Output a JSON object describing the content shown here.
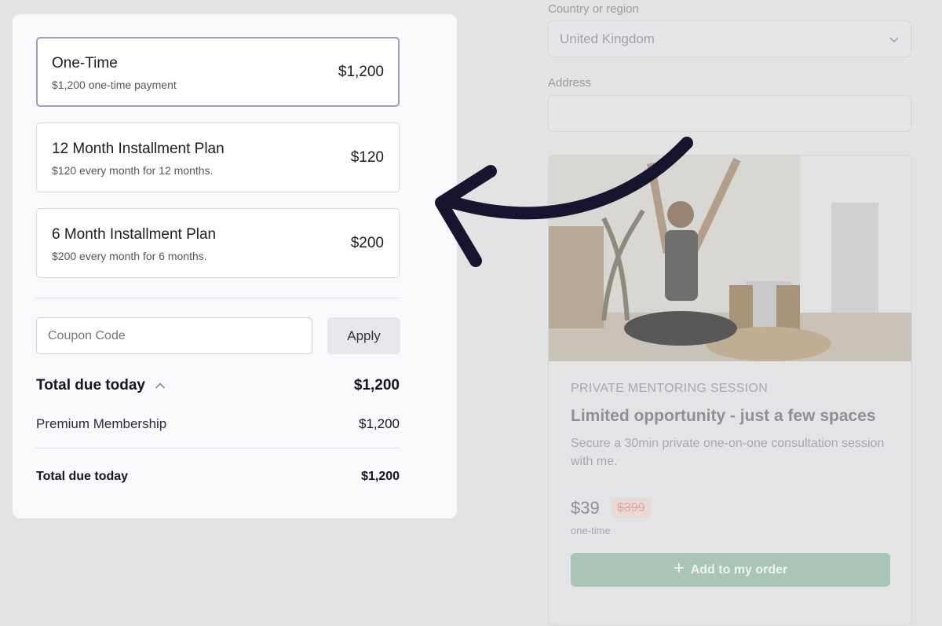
{
  "checkout": {
    "country_label": "Country or region",
    "country_value": "United Kingdom",
    "address_label": "Address"
  },
  "offer": {
    "kicker": "PRIVATE MENTORING SESSION",
    "title": "Limited opportunity - just a few spaces",
    "description": "Secure a 30min private one-on-one consultation session with me.",
    "price": "$39",
    "old_price": "$399",
    "price_note": "one-time",
    "add_button": "Add to my order"
  },
  "plans": [
    {
      "name": "One-Time",
      "sub": "$1,200 one-time payment",
      "price": "$1,200",
      "selected": true
    },
    {
      "name": "12 Month Installment Plan",
      "sub": "$120 every month for 12 months.",
      "price": "$120",
      "selected": false
    },
    {
      "name": "6 Month Installment Plan",
      "sub": "$200 every month for 6 months.",
      "price": "$200",
      "selected": false
    }
  ],
  "coupon": {
    "placeholder": "Coupon Code",
    "value": "",
    "apply_label": "Apply"
  },
  "summary": {
    "total_label": "Total due today",
    "total_amount": "$1,200",
    "items": [
      {
        "name": "Premium Membership",
        "amount": "$1,200"
      }
    ],
    "final_label": "Total due today",
    "final_amount": "$1,200"
  },
  "colors": {
    "selected_border": "#a798b8",
    "add_button_bg": "#a8c5b5",
    "arrow": "#16142e"
  }
}
